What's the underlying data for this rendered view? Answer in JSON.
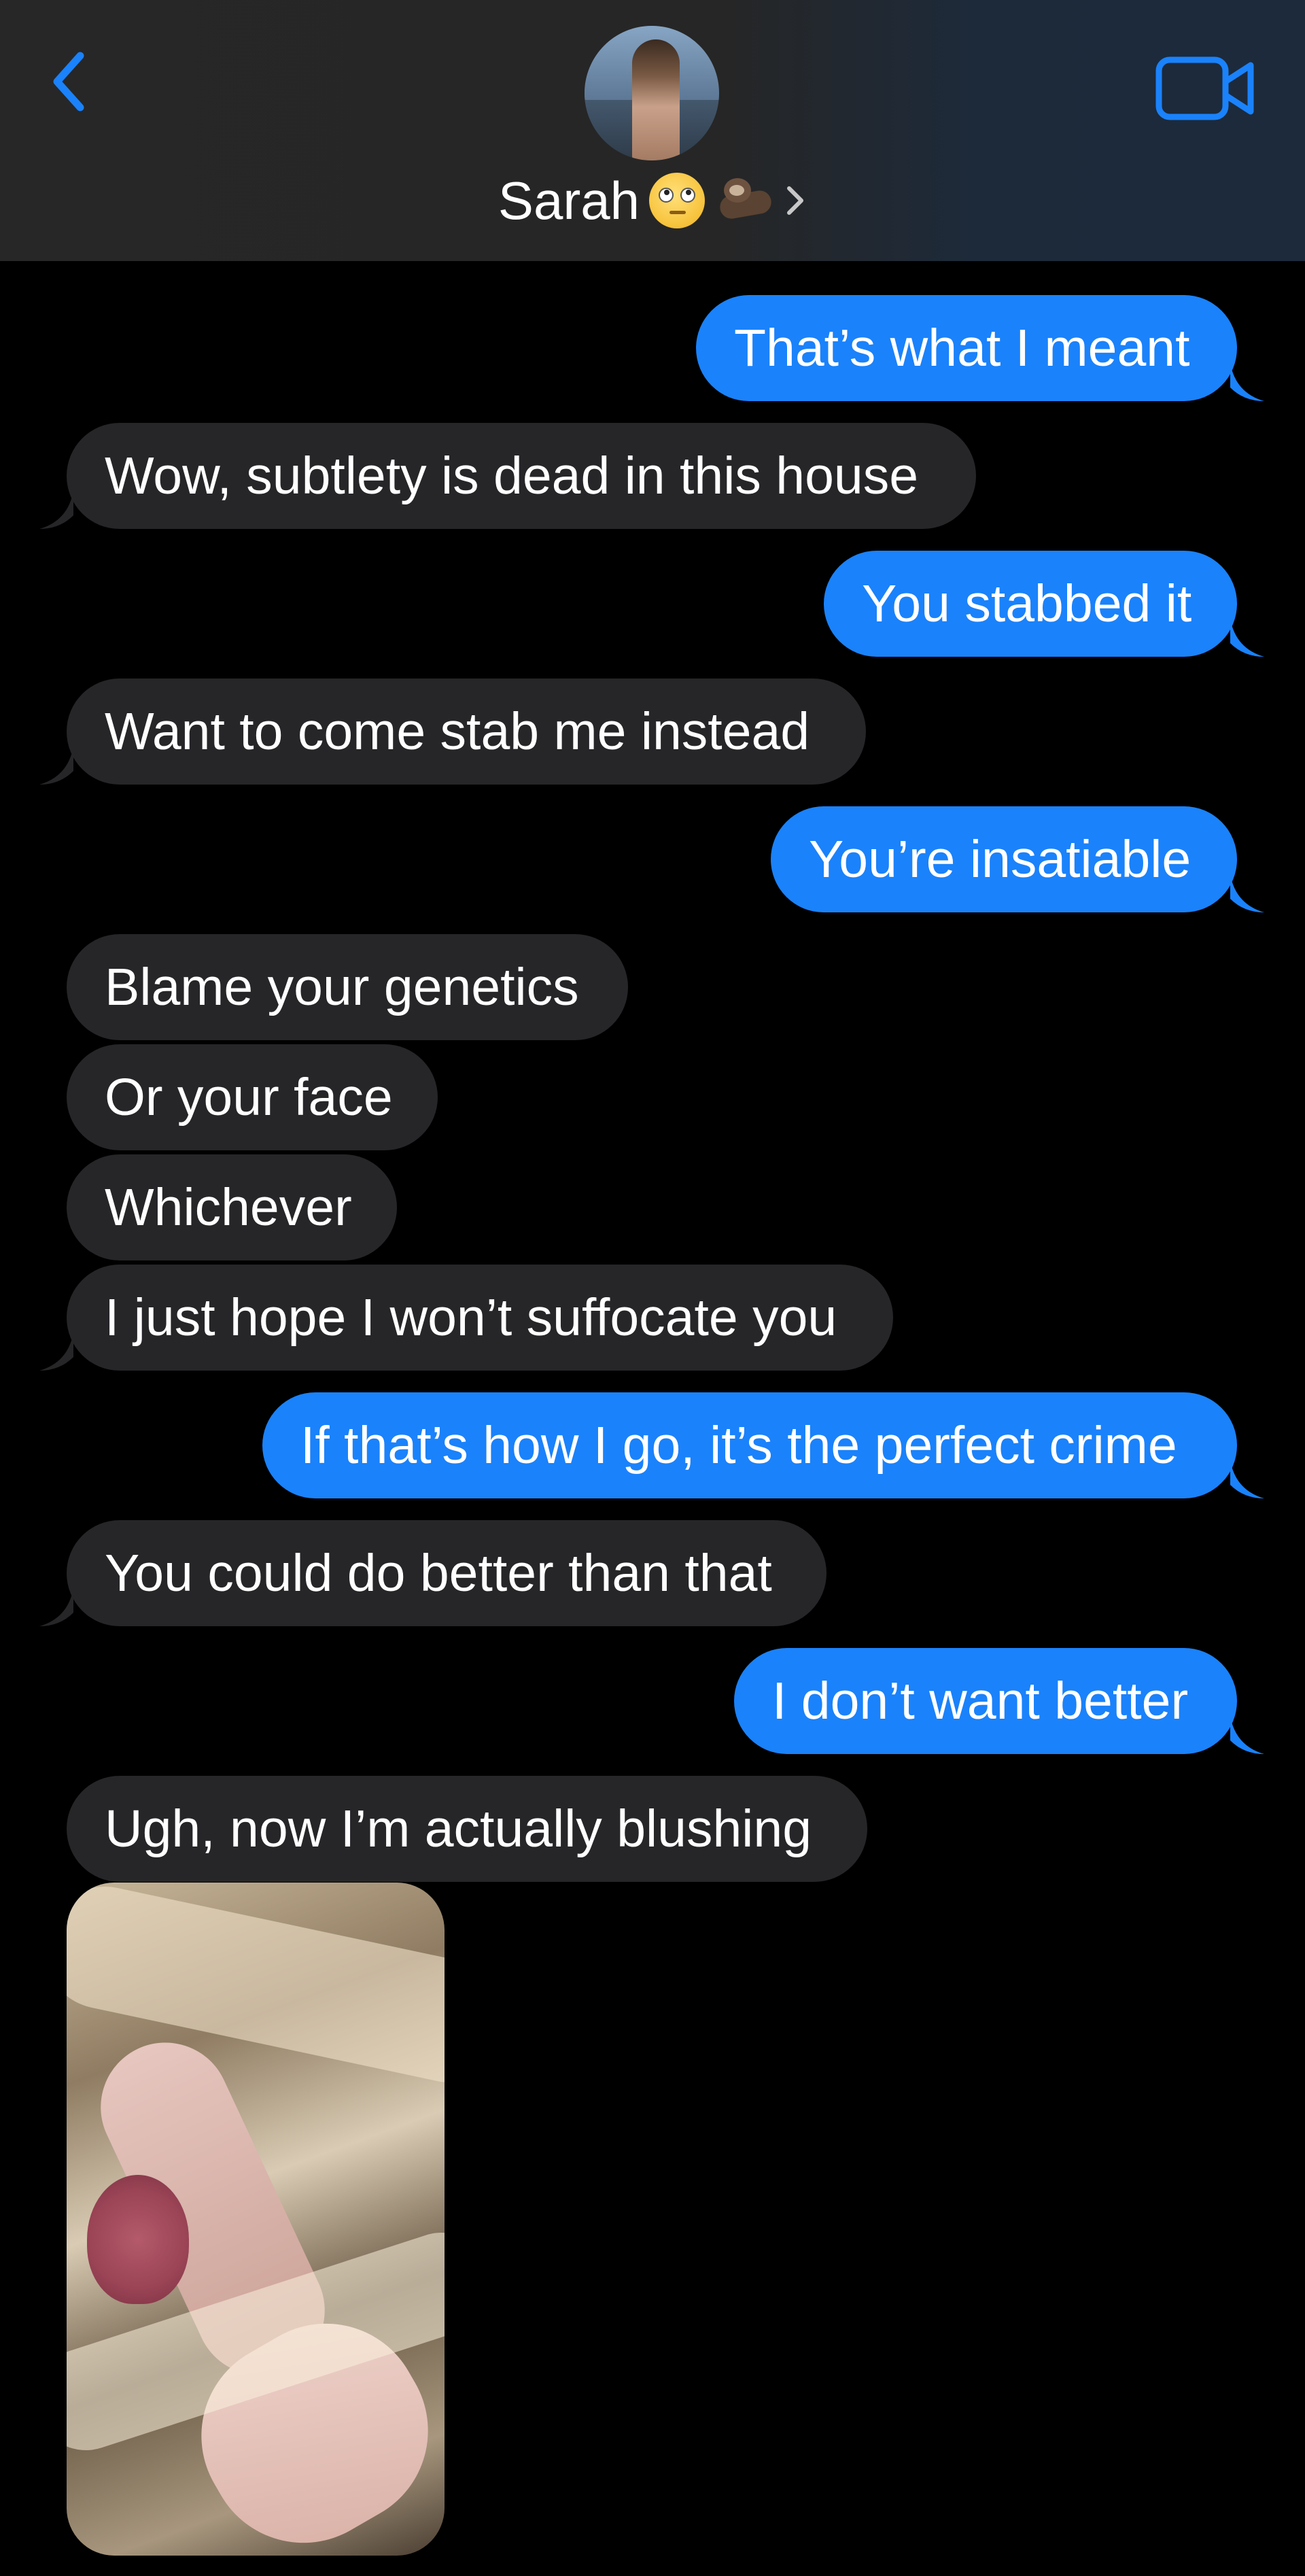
{
  "header": {
    "contact_name": "Sarah",
    "contact_emojis": [
      "face-with-rolling-eyes",
      "otter"
    ],
    "icons": {
      "back": "back-chevron-icon",
      "video": "video-camera-icon",
      "chevron": "chevron-right-icon"
    }
  },
  "colors": {
    "outgoing": "#1a82fb",
    "incoming": "#262629",
    "accent": "#1a82fb",
    "background": "#000000"
  },
  "messages": [
    {
      "from": "me",
      "text": "That’s what I meant"
    },
    {
      "from": "them",
      "text": "Wow, subtlety is dead in this house"
    },
    {
      "from": "me",
      "text": "You stabbed it"
    },
    {
      "from": "them",
      "text": "Want to come stab me instead"
    },
    {
      "from": "me",
      "text": "You’re insatiable"
    },
    {
      "from": "them",
      "text": "Blame your genetics"
    },
    {
      "from": "them",
      "text": "Or your face"
    },
    {
      "from": "them",
      "text": "Whichever"
    },
    {
      "from": "them",
      "text": "I just hope I won’t suffocate you"
    },
    {
      "from": "me",
      "text": "If that’s how I go, it’s the perfect crime"
    },
    {
      "from": "them",
      "text": "You could do better than that"
    },
    {
      "from": "me",
      "text": "I don’t want better"
    },
    {
      "from": "them",
      "text": "Ugh, now I’m actually blushing"
    },
    {
      "from": "them",
      "type": "photo"
    }
  ]
}
